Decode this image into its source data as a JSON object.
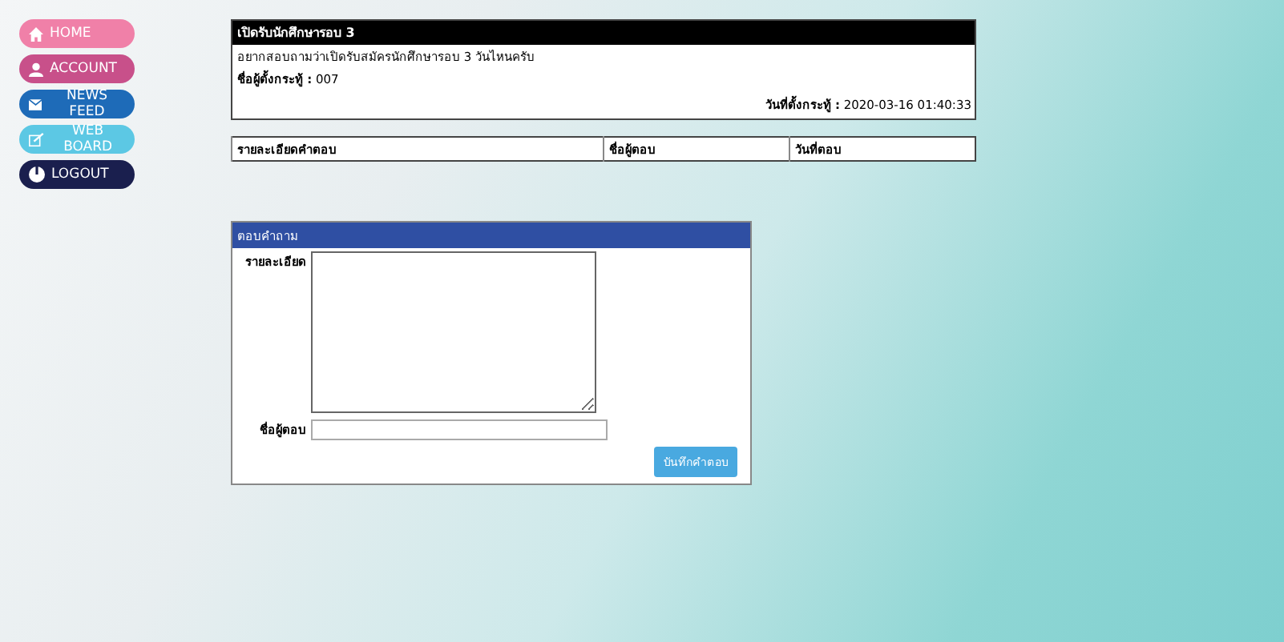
{
  "menu": [
    {
      "label": "HOME",
      "kind": "home",
      "color": "#f080a8"
    },
    {
      "label": "ACCOUNT",
      "kind": "account",
      "color": "#c8508a"
    },
    {
      "label": "NEWS FEED",
      "kind": "news",
      "color": "#1e6bb8"
    },
    {
      "label": "WEB BOARD",
      "kind": "board",
      "color": "#5cc8e4"
    },
    {
      "label": "LOGOUT",
      "kind": "logout",
      "color": "#1a1f4e"
    }
  ],
  "post": {
    "title": "เปิดรับนักศึกษารอบ 3",
    "body": "อยากสอบถามว่าเปิดรับสมัครนักศึกษารอบ 3 วันไหนครับ",
    "author": "**ชื่อผู้ตั้งกระทู้ :** 007",
    "date": "**วันที่ตั้งกระทู้ :** 2020-03-16 01:40:33"
  },
  "answers_table": {
    "columns": [
      "รายละเอียดคำตอบ",
      "ชื่อผู้ตอบ",
      "วันที่ตอบ"
    ]
  },
  "answer_form": {
    "title": "ตอบคำถาม",
    "detail_label": "รายละเอียด",
    "name_label": "ชื่อผู้ตอบ",
    "submit": "บันทึกคำตอบ"
  }
}
